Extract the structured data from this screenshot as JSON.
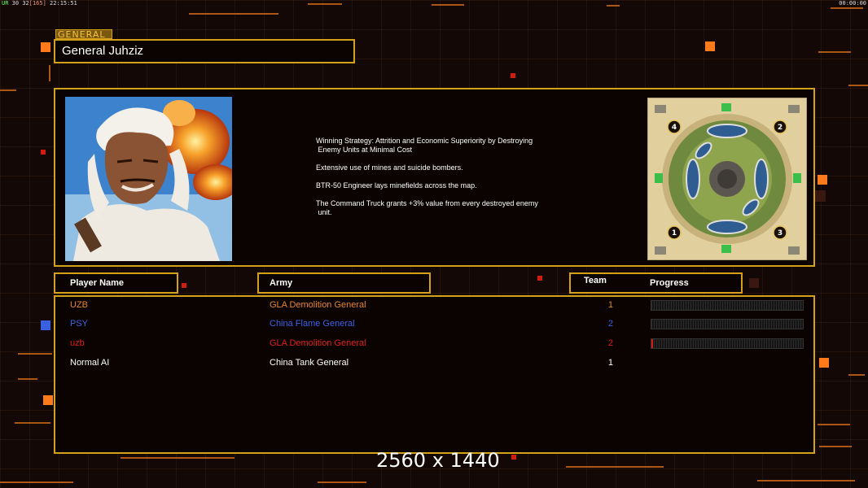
{
  "top_status": {
    "left_prefix": "UR",
    "left_mid": "30",
    "left_val": "32",
    "left_bracket": "[165]",
    "left_time": "22:15:51",
    "right_time": "00:00:00"
  },
  "general": {
    "tag_label": "GENERAL",
    "name": "General Juhziz"
  },
  "description": [
    "Winning Strategy: Attrition and Economic Superiority by Destroying\n Enemy Units at Minimal Cost",
    "Extensive use of mines and suicide bombers.",
    "BTR-50 Engineer lays minefields across the map.",
    "The Command Truck grants +3% value from every destroyed enemy\n unit."
  ],
  "minimap": {
    "start_positions": [
      "4",
      "2",
      "1",
      "3"
    ]
  },
  "headers": {
    "player_name": "Player Name",
    "army": "Army",
    "team": "Team",
    "progress": "Progress"
  },
  "players": [
    {
      "name": "UZB",
      "army": "GLA Demolition General",
      "team": "1",
      "color": "#e8862f",
      "progress": 0,
      "show_bar": true
    },
    {
      "name": "PSY",
      "army": "China Flame General",
      "team": "2",
      "color": "#3f62e8",
      "progress": 0,
      "show_bar": true
    },
    {
      "name": "uzb",
      "army": "GLA Demolition General",
      "team": "2",
      "color": "#e0211a",
      "progress": 0.01,
      "show_bar": true
    },
    {
      "name": "Normal AI",
      "army": "China Tank General",
      "team": "1",
      "color": "#ffffff",
      "progress": 0,
      "show_bar": false
    }
  ],
  "resolution_text": "2560 x 1440",
  "colors": {
    "accent_gold": "#d4a21a",
    "deco_orange": "#ff7a1a",
    "panel_bg": "#0b0302"
  }
}
